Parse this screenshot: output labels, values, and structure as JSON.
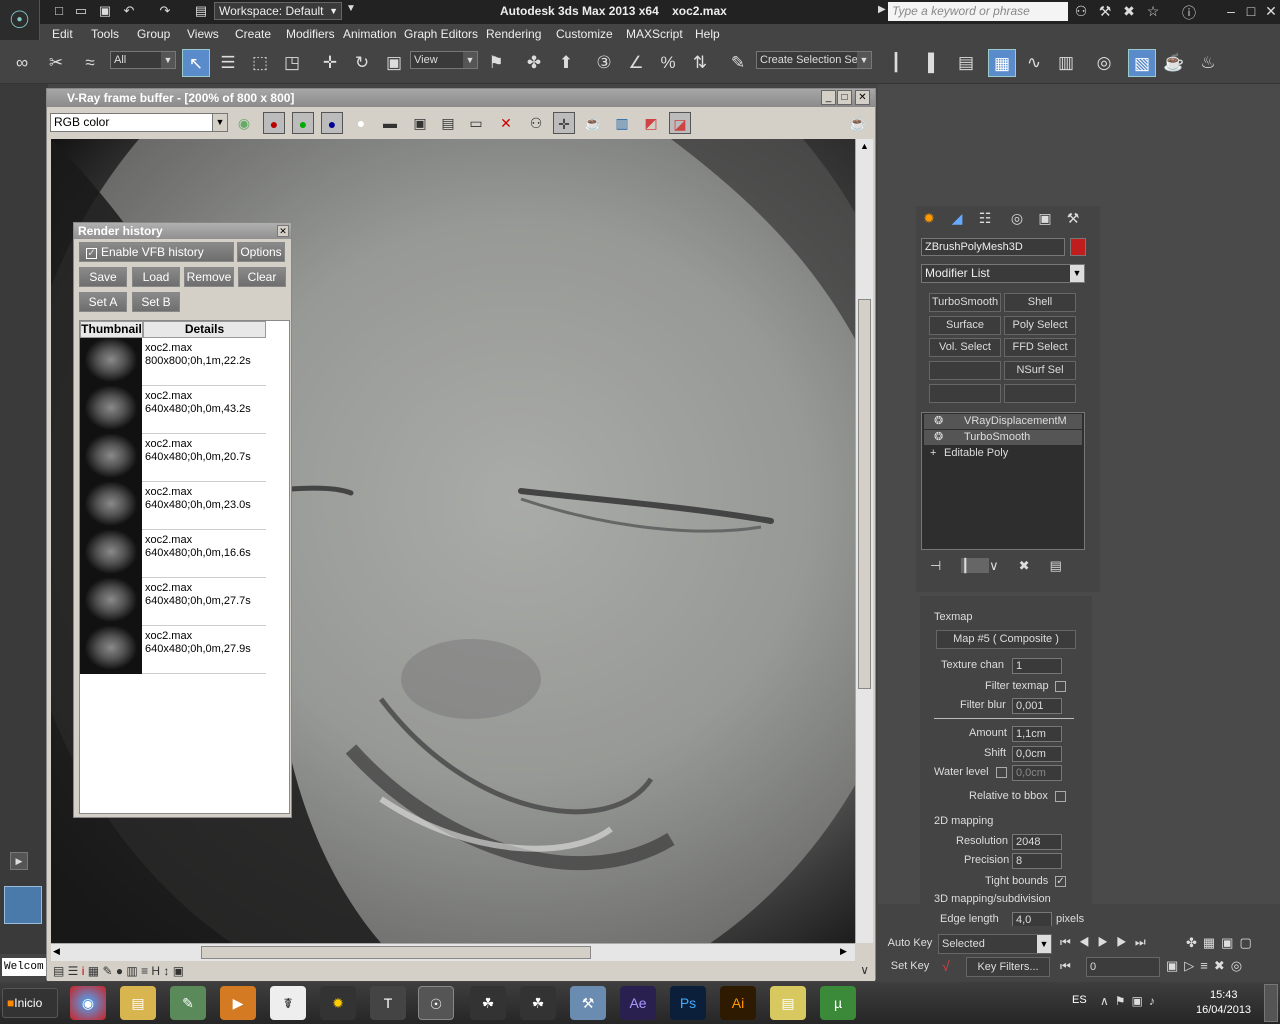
{
  "app": {
    "title": "Autodesk 3ds Max  2013 x64",
    "file": "xoc2.max",
    "workspace": "Workspace: Default",
    "search_placeholder": "Type a keyword or phrase"
  },
  "menu": [
    "Edit",
    "Tools",
    "Group",
    "Views",
    "Create",
    "Modifiers",
    "Animation",
    "Graph Editors",
    "Rendering",
    "Customize",
    "MAXScript",
    "Help"
  ],
  "toolbar": {
    "filter": "All",
    "ref_coord": "View",
    "selection_set": "Create Selection Se"
  },
  "vfb": {
    "title": "V-Ray frame buffer - [200% of 800 x 800]",
    "channel": "RGB color"
  },
  "render_history": {
    "title": "Render history",
    "enable_label": "Enable VFB history",
    "enable_checked": true,
    "options": "Options",
    "save": "Save",
    "load": "Load",
    "remove": "Remove",
    "clear": "Clear",
    "set_a": "Set A",
    "set_b": "Set B",
    "col_thumbnail": "Thumbnail",
    "col_details": "Details",
    "entries": [
      {
        "file": "xoc2.max",
        "info": "800x800;0h,1m,22.2s"
      },
      {
        "file": "xoc2.max",
        "info": "640x480;0h,0m,43.2s"
      },
      {
        "file": "xoc2.max",
        "info": "640x480;0h,0m,20.7s"
      },
      {
        "file": "xoc2.max",
        "info": "640x480;0h,0m,23.0s"
      },
      {
        "file": "xoc2.max",
        "info": "640x480;0h,0m,16.6s"
      },
      {
        "file": "xoc2.max",
        "info": "640x480;0h,0m,27.7s"
      },
      {
        "file": "xoc2.max",
        "info": "640x480;0h,0m,27.9s"
      }
    ]
  },
  "command_panel": {
    "object_name": "ZBrushPolyMesh3D",
    "object_color": "#c01e1e",
    "modifier_list": "Modifier List",
    "modifier_buttons": [
      "TurboSmooth",
      "Shell",
      "Surface",
      "Poly Select",
      "Vol. Select",
      "FFD Select",
      "",
      "NSurf Sel",
      "",
      ""
    ],
    "stack": [
      "VRayDisplacementM",
      "TurboSmooth",
      "Editable Poly"
    ],
    "params": {
      "texmap_label": "Texmap",
      "texmap_value": "Map #5  ( Composite )",
      "texture_chan_label": "Texture chan",
      "texture_chan": "1",
      "filter_texmap_label": "Filter texmap",
      "filter_blur_label": "Filter blur",
      "filter_blur": "0,001",
      "amount_label": "Amount",
      "amount": "1,1cm",
      "shift_label": "Shift",
      "shift": "0,0cm",
      "water_level_label": "Water level",
      "water_level": "0,0cm",
      "relative_bbox_label": "Relative to bbox",
      "mapping_2d": "2D mapping",
      "resolution_label": "Resolution",
      "resolution": "2048",
      "precision_label": "Precision",
      "precision": "8",
      "tight_bounds_label": "Tight bounds",
      "tight_bounds_checked": true,
      "mapping_3d": "3D mapping/subdivision",
      "edge_length_label": "Edge length",
      "edge_length": "4,0",
      "pixels_label": "pixels"
    }
  },
  "anim": {
    "auto_key": "Auto Key",
    "selected": "Selected",
    "set_key": "Set Key",
    "key_filters": "Key Filters...",
    "frame": "0"
  },
  "listener": "Welcom",
  "taskbar": {
    "start": "Inicio",
    "lang": "ES",
    "time": "15:43",
    "date": "16/04/2013"
  }
}
